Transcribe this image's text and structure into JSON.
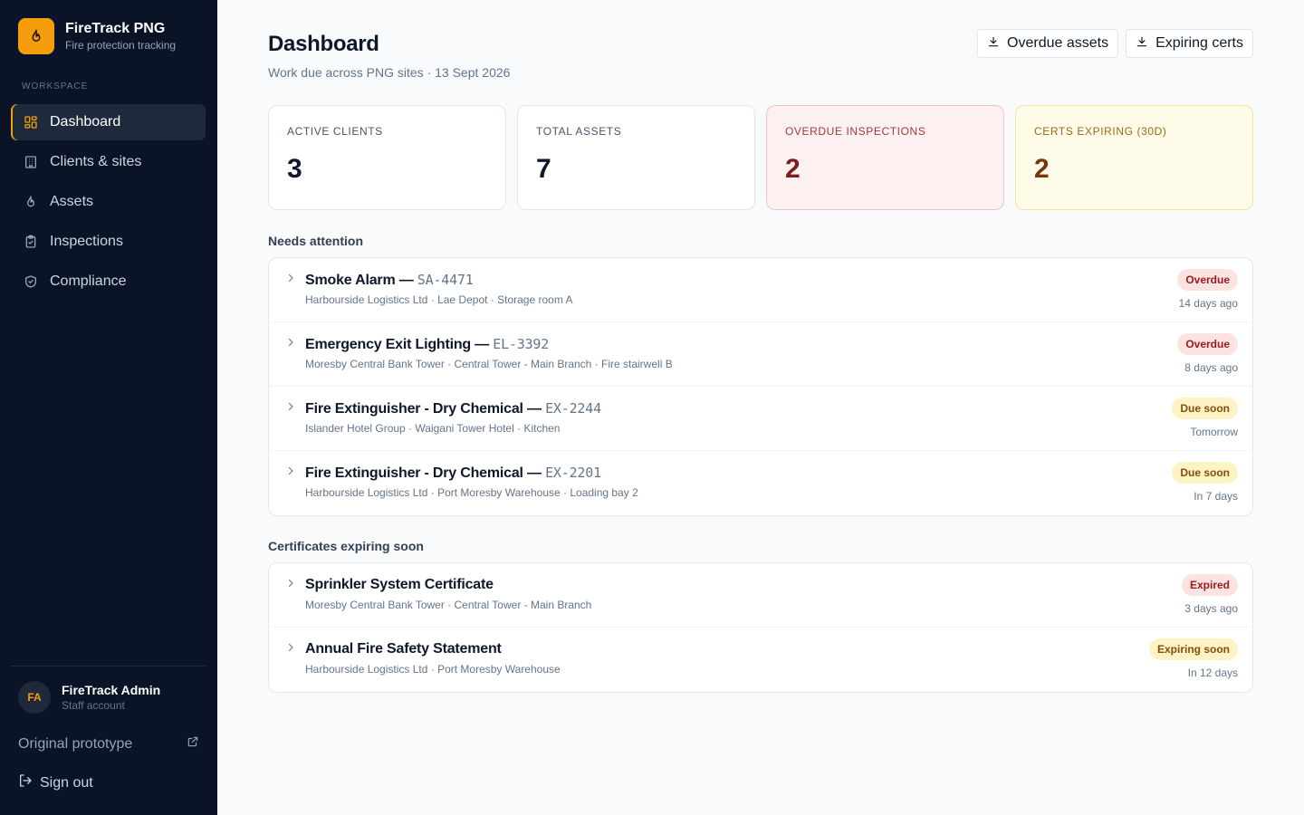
{
  "brand": {
    "name": "FireTrack PNG",
    "subtitle": "Fire protection tracking",
    "accent": "#f59e0b"
  },
  "sidebar": {
    "section_label": "WORKSPACE",
    "items": [
      {
        "label": "Dashboard",
        "icon": "dashboard-grid-icon",
        "active": true
      },
      {
        "label": "Clients & sites",
        "icon": "building-icon"
      },
      {
        "label": "Assets",
        "icon": "flame-icon"
      },
      {
        "label": "Inspections",
        "icon": "clipboard-check-icon"
      },
      {
        "label": "Compliance",
        "icon": "shield-check-icon"
      }
    ],
    "user": {
      "initials": "FA",
      "name": "FireTrack Admin",
      "role": "Staff account"
    },
    "prototype_link": "Original prototype",
    "sign_out": "Sign out"
  },
  "header": {
    "title": "Dashboard",
    "subtitle": "Work due across PNG sites · 13 Sept 2026",
    "actions": [
      {
        "label": "Overdue assets",
        "icon": "download-icon"
      },
      {
        "label": "Expiring certs",
        "icon": "download-icon"
      }
    ]
  },
  "stats": [
    {
      "label": "ACTIVE CLIENTS",
      "value": "3"
    },
    {
      "label": "TOTAL ASSETS",
      "value": "7"
    },
    {
      "label": "OVERDUE INSPECTIONS",
      "value": "2",
      "tone": "red"
    },
    {
      "label": "CERTS EXPIRING (30D)",
      "value": "2",
      "tone": "amber"
    }
  ],
  "attention": {
    "title": "Needs attention",
    "items": [
      {
        "name": "Smoke Alarm — ",
        "code": "SA-4471",
        "location": "Harbourside Logistics Ltd · Lae Depot · Storage room A",
        "status": "Overdue",
        "tone": "red",
        "when": "14 days ago"
      },
      {
        "name": "Emergency Exit Lighting — ",
        "code": "EL-3392",
        "location": "Moresby Central Bank Tower · Central Tower - Main Branch · Fire stairwell B",
        "status": "Overdue",
        "tone": "red",
        "when": "8 days ago"
      },
      {
        "name": "Fire Extinguisher - Dry Chemical — ",
        "code": "EX-2244",
        "location": "Islander Hotel Group · Waigani Tower Hotel · Kitchen",
        "status": "Due soon",
        "tone": "amber",
        "when": "Tomorrow"
      },
      {
        "name": "Fire Extinguisher - Dry Chemical — ",
        "code": "EX-2201",
        "location": "Harbourside Logistics Ltd · Port Moresby Warehouse · Loading bay 2",
        "status": "Due soon",
        "tone": "amber",
        "when": "In 7 days"
      }
    ]
  },
  "certificates": {
    "title": "Certificates expiring soon",
    "items": [
      {
        "name": "Sprinkler System Certificate",
        "location": "Moresby Central Bank Tower · Central Tower - Main Branch",
        "status": "Expired",
        "tone": "red",
        "when": "3 days ago"
      },
      {
        "name": "Annual Fire Safety Statement",
        "location": "Harbourside Logistics Ltd · Port Moresby Warehouse",
        "status": "Expiring soon",
        "tone": "amber",
        "when": "In 12 days"
      }
    ]
  }
}
